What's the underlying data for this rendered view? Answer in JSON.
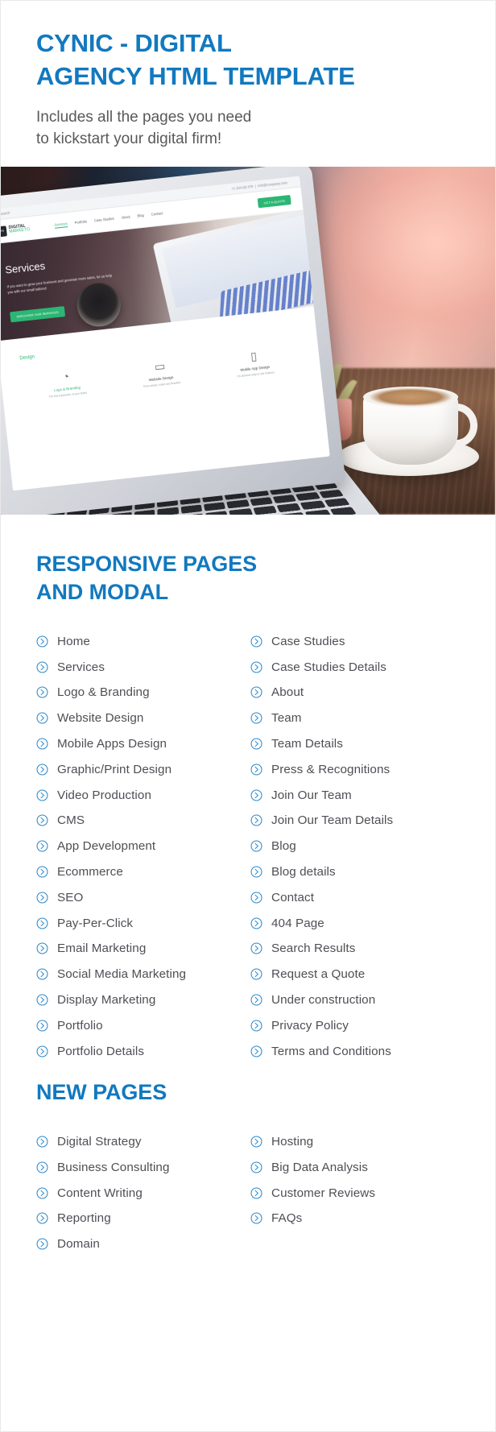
{
  "hero": {
    "title_line1": "CYNIC - DIGITAL",
    "title_line2": "AGENCY HTML TEMPLATE",
    "subtitle_line1": "Includes all the pages you need",
    "subtitle_line2": "to kickstart your digital firm!"
  },
  "colors": {
    "accent_blue": "#1179BF",
    "body_text": "#4D4F54",
    "subtitle_text": "#595959",
    "mini_green": "#2BB673"
  },
  "preview": {
    "topbar": {
      "search_placeholder": "Search",
      "phone": "+1 234 (5) 678",
      "email": "info@company.com"
    },
    "logo": {
      "mark": "CYN",
      "line1": "DIGITAL",
      "line2": "MARKETO"
    },
    "nav": [
      "Services",
      "Portfolio",
      "Case Studies",
      "About",
      "Blog",
      "Contact"
    ],
    "nav_active": "Services",
    "cta_label": "GET A QUOTE",
    "hero": {
      "title": "Services",
      "paragraph": "If you want to grow your business and generate more sales, let us help you with our small tailored",
      "button_label": "DISCOVER OUR SERVICES"
    },
    "section_title": "Design",
    "cards": [
      {
        "icon": "palette-icon",
        "glyph": "◔",
        "name": "Logo & Branding",
        "desc": "The first impression of your brand"
      },
      {
        "icon": "monitor-icon",
        "glyph": "▭",
        "name": "Website Design",
        "desc": "Think simple, smart and beautiful"
      },
      {
        "icon": "mobile-icon",
        "glyph": "▯",
        "name": "Mobile App Design",
        "desc": "On-demand easy-to-use features"
      }
    ]
  },
  "responsive": {
    "title_line1": "RESPONSIVE PAGES",
    "title_line2": "AND MODAL",
    "left_items": [
      "Home",
      "Services",
      "Logo & Branding",
      "Website Design",
      "Mobile Apps Design",
      "Graphic/Print Design",
      "Video Production",
      "CMS",
      "App Development",
      "Ecommerce",
      "SEO",
      "Pay-Per-Click",
      "Email Marketing",
      "Social Media Marketing",
      "Display Marketing",
      "Portfolio",
      "Portfolio Details"
    ],
    "right_items": [
      "Case Studies",
      "Case Studies Details",
      "About",
      "Team",
      "Team Details",
      "Press & Recognitions",
      "Join Our Team",
      "Join Our Team Details",
      "Blog",
      "Blog details",
      "Contact",
      "404 Page",
      "Search Results",
      "Request a Quote",
      "Under construction",
      "Privacy Policy",
      "Terms and Conditions"
    ]
  },
  "new_pages": {
    "title": "NEW PAGES",
    "left_items": [
      "Digital Strategy",
      "Business Consulting",
      "Content Writing",
      "Reporting",
      "Domain"
    ],
    "right_items": [
      "Hosting",
      "Big Data Analysis",
      "Customer Reviews",
      "FAQs"
    ]
  },
  "icons": {
    "list_bullet": "circle-chevron-right-icon"
  }
}
